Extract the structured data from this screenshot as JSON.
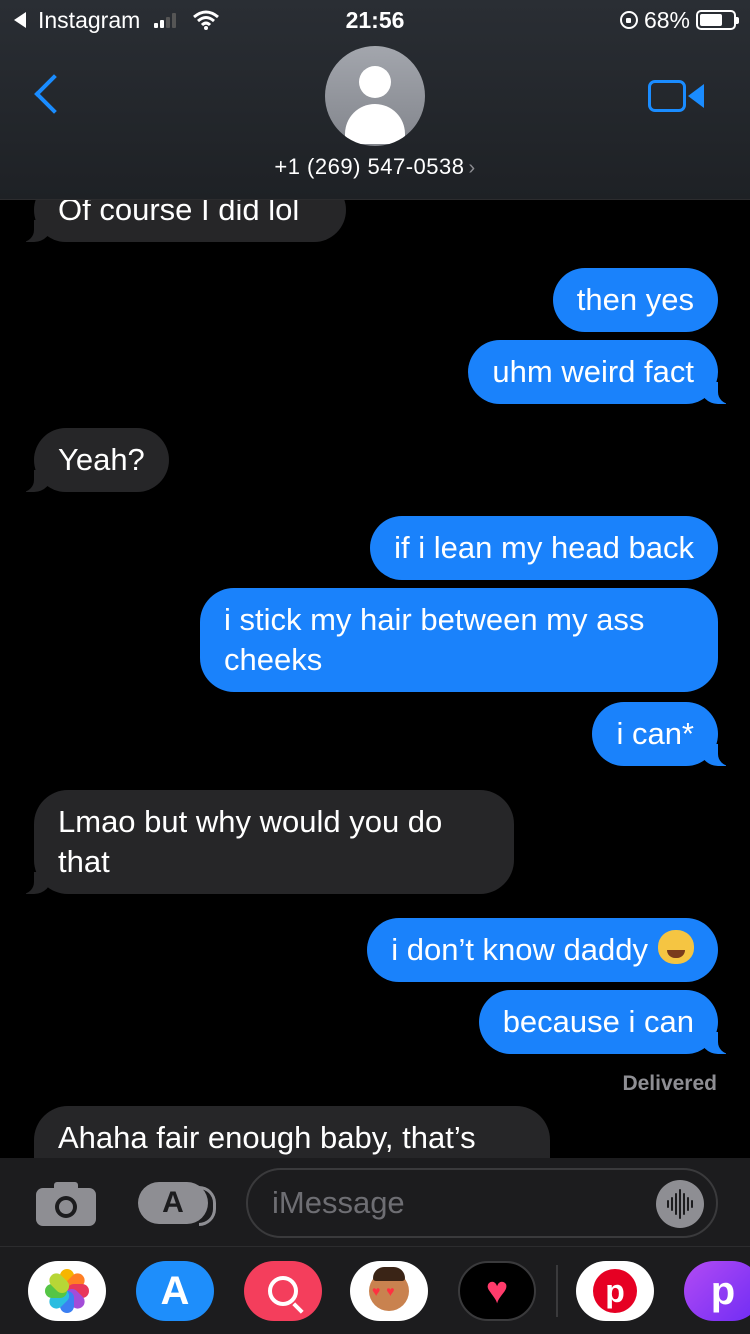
{
  "status_bar": {
    "back_app": "Instagram",
    "time": "21:56",
    "battery": "68%",
    "battery_level": 0.68
  },
  "header": {
    "contact": "+1 (269) 547-0538",
    "chevron": "›"
  },
  "messages": [
    {
      "dir": "in",
      "text": "Of course I did lol"
    },
    {
      "dir": "out",
      "text": "then yes"
    },
    {
      "dir": "out",
      "text": "uhm weird fact"
    },
    {
      "dir": "in",
      "text": "Yeah?"
    },
    {
      "dir": "out",
      "text": "if i lean my head back"
    },
    {
      "dir": "out",
      "text": "i stick my hair between my ass cheeks"
    },
    {
      "dir": "out",
      "text": "i can*"
    },
    {
      "dir": "in",
      "text": "Lmao but why would you do that"
    },
    {
      "dir": "out",
      "text": "i don’t know daddy",
      "emoji": "joy-cat-emoji"
    },
    {
      "dir": "out",
      "text": "because i can"
    },
    {
      "dir": "in",
      "text": "Ahaha fair enough baby, that’s"
    }
  ],
  "delivered": "Delivered",
  "input": {
    "placeholder": "iMessage"
  },
  "app_drawer": {
    "icons": [
      "photos-icon",
      "app-store-icon",
      "web-search-icon",
      "memoji-icon",
      "heart-app-icon",
      "pinterest-icon",
      "picsart-icon"
    ],
    "pinterest_letter": "p",
    "picsart_letter": "p"
  },
  "colors": {
    "outgoing_bubble": "#1a82fb",
    "incoming_bubble": "#262628",
    "accent": "#1a8cff"
  }
}
